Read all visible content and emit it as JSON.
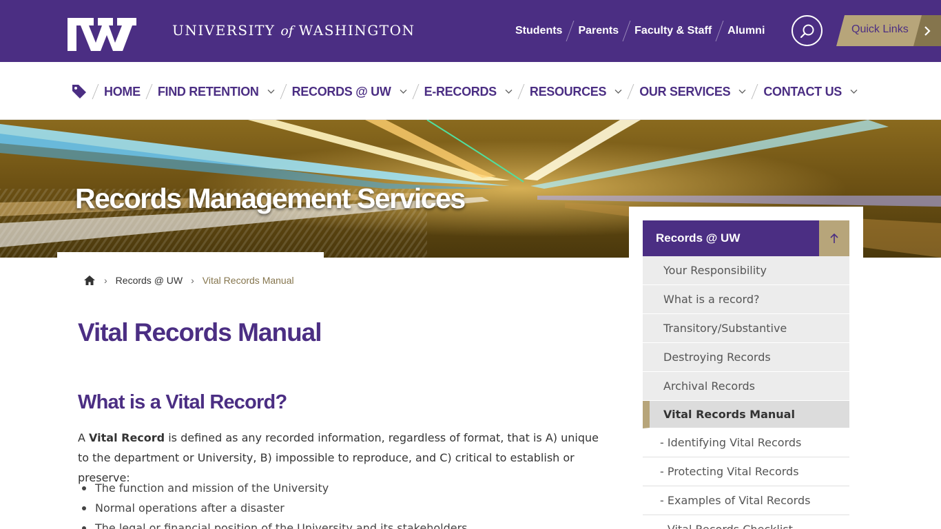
{
  "header": {
    "wordmark": {
      "part1": "UNIVERSITY",
      "of": "of",
      "part2": "WASHINGTON"
    },
    "audience_links": [
      "Students",
      "Parents",
      "Faculty & Staff",
      "Alumni"
    ],
    "quick_links_label": "Quick Links",
    "icons": {
      "logo": "uw-w-logo",
      "search": "search-icon",
      "quick_links_arrow": "chevron-right-icon"
    }
  },
  "nav": {
    "tag_icon": "tag-icon",
    "items": [
      {
        "label": "HOME",
        "has_dropdown": false
      },
      {
        "label": "FIND RETENTION",
        "has_dropdown": true
      },
      {
        "label": "RECORDS @ UW",
        "has_dropdown": true
      },
      {
        "label": "E-RECORDS",
        "has_dropdown": true
      },
      {
        "label": "RESOURCES",
        "has_dropdown": true
      },
      {
        "label": "OUR SERVICES",
        "has_dropdown": true
      },
      {
        "label": "CONTACT US",
        "has_dropdown": true
      }
    ]
  },
  "hero": {
    "title": "Records Management Services"
  },
  "breadcrumb": {
    "home_icon": "home-icon",
    "items": [
      "Records @ UW",
      "Vital Records Manual"
    ]
  },
  "content": {
    "page_title": "Vital Records Manual",
    "section_title": "What is a Vital Record?",
    "paragraph": {
      "prefix": "A ",
      "bold": "Vital Record",
      "rest": " is defined as any recorded information, regardless of format, that is A) unique to the department or University, B) impossible to reproduce, and C) critical to establish or preserve:"
    },
    "bullets": [
      "The function and mission of the University",
      "Normal operations after a disaster",
      "The legal or financial position of the University and its stakeholders"
    ]
  },
  "sidebar": {
    "header": "Records @ UW",
    "up_icon": "arrow-up-icon",
    "items": [
      "Your Responsibility",
      "What is a record?",
      "Transitory/Substantive",
      "Destroying Records",
      "Archival Records"
    ],
    "active": "Vital Records Manual",
    "subitems": [
      "- Identifying Vital Records",
      "- Protecting Vital Records",
      "- Examples of Vital Records",
      "- Vital Records Checklist"
    ]
  },
  "colors": {
    "purple": "#4b2e83",
    "gold": "#b7a57a",
    "dark_gold": "#85754d"
  }
}
